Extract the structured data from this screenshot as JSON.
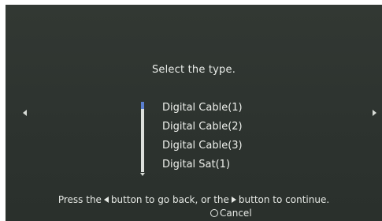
{
  "screen": {
    "prompt": "Select the type."
  },
  "type_list": {
    "items": [
      {
        "label": "Digital Cable(1)"
      },
      {
        "label": "Digital Cable(2)"
      },
      {
        "label": "Digital Cable(3)"
      },
      {
        "label": "Digital Sat(1)"
      }
    ]
  },
  "footer": {
    "hint_part1": "Press the",
    "hint_part2": "button to go back, or the",
    "hint_part3": "button to continue.",
    "cancel_label": "Cancel"
  },
  "icons": {
    "nav_left": "left-triangle-icon",
    "nav_right": "right-triangle-icon",
    "cancel": "circle-button-icon"
  },
  "colors": {
    "background": "#2e3430",
    "text": "#e9ece8",
    "scroll_thumb": "#5a7fd0"
  }
}
